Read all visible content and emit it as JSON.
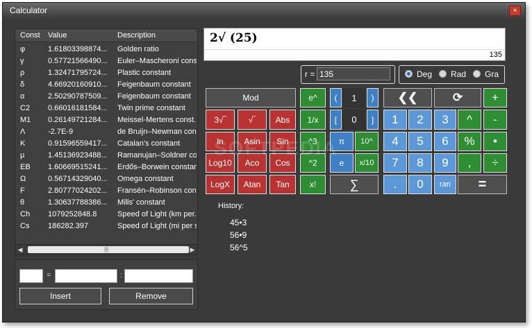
{
  "window": {
    "title": "Calculator",
    "close_label": "×"
  },
  "constants": {
    "columns": [
      "Const",
      "Value",
      "Description"
    ],
    "rows": [
      {
        "sym": "φ",
        "value": "1.61803398874...",
        "desc": "Golden ratio"
      },
      {
        "sym": "γ",
        "value": "0.57721566490...",
        "desc": "Euler–Mascheroni cons"
      },
      {
        "sym": "ρ",
        "value": "1.32471795724...",
        "desc": "Plastic constant"
      },
      {
        "sym": "δ",
        "value": "4.66920160910...",
        "desc": "Feigenbaum constant"
      },
      {
        "sym": "α",
        "value": "2.50290787509...",
        "desc": "Feigenbaum constant"
      },
      {
        "sym": "C2",
        "value": "0.66016181584...",
        "desc": "Twin prime constant"
      },
      {
        "sym": "M1",
        "value": "0.26149721284...",
        "desc": "Meissel-Mertens const..."
      },
      {
        "sym": "Λ",
        "value": "-2.7E-9",
        "desc": "de Bruijn–Newman con..."
      },
      {
        "sym": "K",
        "value": "0.91596559417...",
        "desc": "Catalan's constant"
      },
      {
        "sym": "μ",
        "value": "1.45136923488...",
        "desc": "Ramanujan–Soldner con..."
      },
      {
        "sym": "EB",
        "value": "1.60669515241...",
        "desc": "Erdős–Borwein constant"
      },
      {
        "sym": "Ω",
        "value": "0.56714329040...",
        "desc": "Omega constant"
      },
      {
        "sym": "F",
        "value": "2.80777024202...",
        "desc": "Fransén–Robinson con..."
      },
      {
        "sym": "θ",
        "value": "1.30637788386...",
        "desc": "Mills' constant"
      },
      {
        "sym": "Ch",
        "value": "1079252848.8",
        "desc": "Speed of Light (km per..."
      },
      {
        "sym": "Cs",
        "value": "186282.397",
        "desc": "Speed of Light (mi per s"
      }
    ],
    "scroll_left": "◀",
    "scroll_right": "▶",
    "scroll_grip": "|||"
  },
  "insert_panel": {
    "eq_sep": "=",
    "colon_sep": ":",
    "insert_label": "Insert",
    "remove_label": "Remove"
  },
  "display": {
    "expression": "2√  (25)",
    "result": "135"
  },
  "r_field": {
    "label": "r =",
    "value": "135"
  },
  "angle_mode": {
    "options": [
      "Deg",
      "Rad",
      "Gra"
    ],
    "selected": "Deg"
  },
  "buttons": {
    "mod": "Mod",
    "root3": "3√‾",
    "sqrt": "√‾",
    "abs": "Abs",
    "ln": "ln",
    "asin": "Asin",
    "sin": "Sin",
    "log10": "Log10",
    "acos": "Aco",
    "cos": "Cos",
    "logx": "LogX",
    "atan": "Atan",
    "tan": "Tan",
    "epow": "e^",
    "inv": "1/x",
    "cube": "^3",
    "square": "^2",
    "fact": "x!",
    "pi": "π",
    "tenpow": "10^",
    "e": "e",
    "xdiv10": "x/10",
    "sum": "∑",
    "paren_open": "(",
    "paren_count": "1",
    "paren_close": ")",
    "bracket_open": "[",
    "bracket_count": "0",
    "bracket_close": "]",
    "backspace": "❮❮",
    "clear": "⟳",
    "plus": "+",
    "minus": "-",
    "caret": "^",
    "percent": "%",
    "dot": "•",
    "comma": ",",
    "divide": "÷",
    "n1": "1",
    "n2": "2",
    "n3": "3",
    "n4": "4",
    "n5": "5",
    "n6": "6",
    "n7": "7",
    "n8": "8",
    "n9": "9",
    "n0": "0",
    "decimal": ".",
    "ran": "ran",
    "equals": "="
  },
  "history": {
    "label": "History:",
    "items": [
      "45•3",
      "56•9",
      "56^5"
    ]
  },
  "watermark": "SOFTPEDIA"
}
